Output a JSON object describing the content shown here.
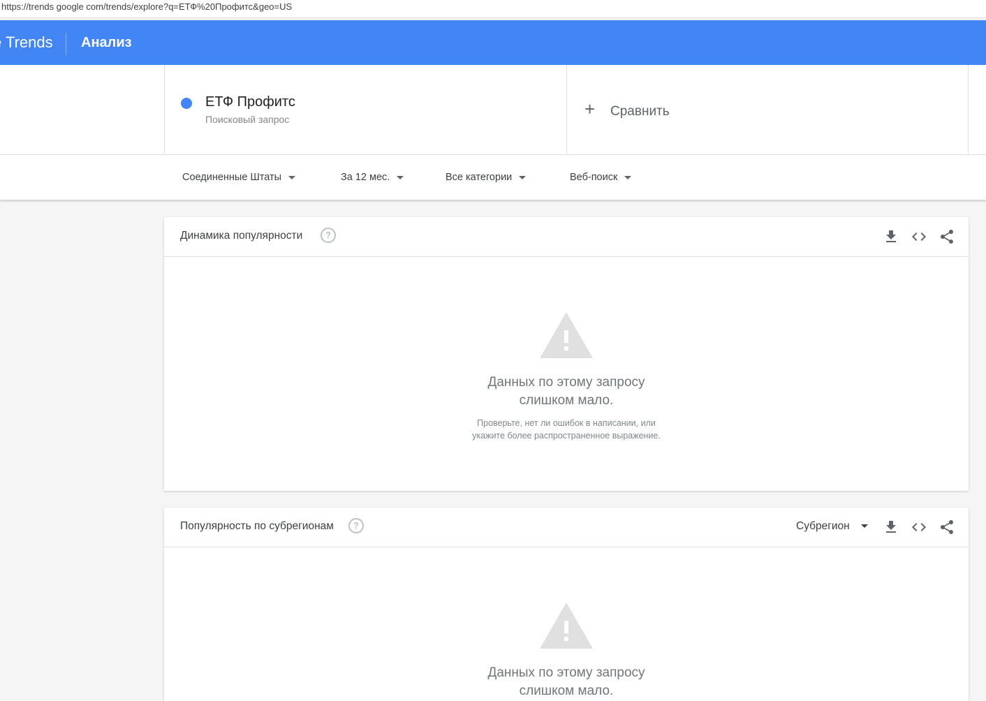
{
  "browser": {
    "url": "https://trends google com/trends/explore?q=ЕТФ%20Профитс&geo=US"
  },
  "header": {
    "brand": "e Trends",
    "title": "Анализ"
  },
  "term": {
    "name": "ЕТФ Профитс",
    "type": "Поисковый запрос",
    "color": "#4285f4"
  },
  "compare": {
    "label": "Сравнить"
  },
  "filters": {
    "region": "Соединенные Штаты",
    "period": "За 12 мес.",
    "category": "Все категории",
    "search_type": "Веб-поиск"
  },
  "interest_over_time": {
    "title": "Динамика популярности",
    "empty_line1": "Данных по этому запросу",
    "empty_line2": "слишком мало.",
    "hint_line1": "Проверьте, нет ли ошибок в написании, или",
    "hint_line2": "укажите более распространенное выражение."
  },
  "interest_by_region": {
    "title": "Популярность по субрегионам",
    "resolution": "Субрегион",
    "empty_line1": "Данных по этому запросу",
    "empty_line2": "слишком мало."
  },
  "icons": {
    "download": "download-icon",
    "embed": "code-icon",
    "share": "share-icon",
    "help": "help-icon",
    "warning": "warning-icon",
    "add": "plus-icon"
  },
  "colors": {
    "app_bar": "#4285f4",
    "background": "#f5f5f5",
    "warning_icon": "#e0e0e0"
  }
}
